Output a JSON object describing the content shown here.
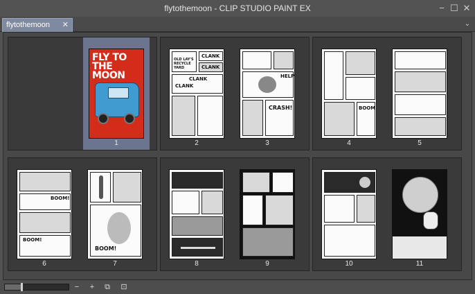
{
  "window": {
    "title": "flytothemoon - CLIP STUDIO PAINT EX",
    "buttons": {
      "minimize": "−",
      "maximize": "☐",
      "close": "✕"
    }
  },
  "tabs": [
    {
      "label": "flytothemoon",
      "close": "✕",
      "active": true
    }
  ],
  "tab_menu": "⌄",
  "cover": {
    "title": "FLY TO THE MOON"
  },
  "pages": [
    {
      "number": "1",
      "selected": true
    },
    {
      "number": "2"
    },
    {
      "number": "3"
    },
    {
      "number": "4"
    },
    {
      "number": "5"
    },
    {
      "number": "6"
    },
    {
      "number": "7"
    },
    {
      "number": "8"
    },
    {
      "number": "9"
    },
    {
      "number": "10"
    },
    {
      "number": "11"
    }
  ],
  "sfx": {
    "p2_clank1": "CLANK",
    "p2_clank2": "CLANK",
    "p2_sign": "OLD LAY'S RECYCLE YARD",
    "p2_clank3": "CLANK",
    "p2_clank4": "CLANK",
    "p3_help": "HELP",
    "p3_crash": "CRASH!",
    "p4_boom": "BOOM!",
    "p6_boom1": "BOOM!",
    "p6_boom2": "BOOM!",
    "p7_boom": "BOOM!"
  },
  "status": {
    "zoom_level": 0.25,
    "zoom_out": "−",
    "zoom_in": "+",
    "fit_icon": "⧉",
    "view_icon": "⊡"
  }
}
